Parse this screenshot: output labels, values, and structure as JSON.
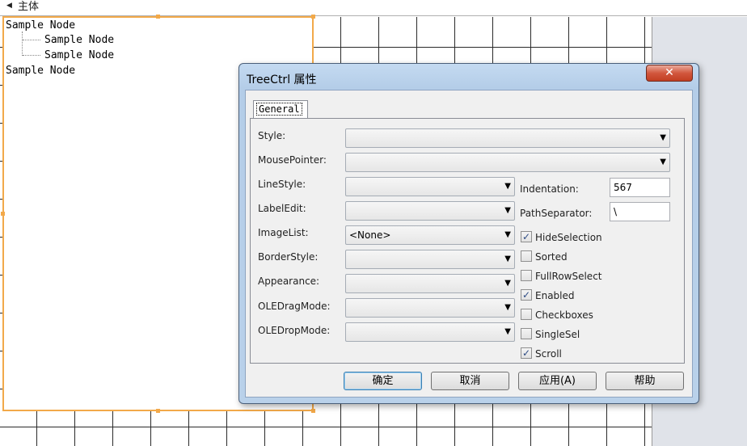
{
  "section": {
    "arrow": "◀",
    "title": "主体"
  },
  "tree": {
    "nodes": [
      "Sample Node",
      "Sample Node",
      "Sample Node",
      "Sample Node"
    ]
  },
  "dialog": {
    "title": "TreeCtrl 属性",
    "close": "✕",
    "tab": "General",
    "fields": {
      "style": "Style:",
      "mousepointer": "MousePointer:",
      "linestyle": "LineStyle:",
      "labeledit": "LabelEdit:",
      "imagelist": "ImageList:",
      "borderstyle": "BorderStyle:",
      "appearance": "Appearance:",
      "oledragmode": "OLEDragMode:",
      "oledropmode": "OLEDropMode:",
      "indentation": "Indentation:",
      "pathseparator": "PathSeparator:"
    },
    "values": {
      "imagelist": "<None>",
      "indentation": "567",
      "pathseparator": "\\"
    },
    "dropdown_glyph": "▼",
    "checkboxes": [
      {
        "label": "HideSelection",
        "checked": true
      },
      {
        "label": "Sorted",
        "checked": false
      },
      {
        "label": "FullRowSelect",
        "checked": false
      },
      {
        "label": "Enabled",
        "checked": true
      },
      {
        "label": "Checkboxes",
        "checked": false
      },
      {
        "label": "SingleSel",
        "checked": false
      },
      {
        "label": "Scroll",
        "checked": true
      }
    ],
    "check_glyph": "✓",
    "buttons": {
      "ok": "确定",
      "cancel": "取消",
      "apply": "应用(A)",
      "help": "帮助"
    }
  }
}
